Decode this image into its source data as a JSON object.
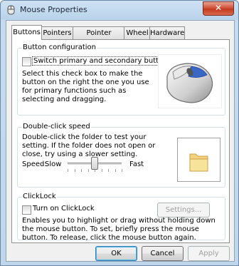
{
  "window": {
    "title": "Mouse Properties",
    "close_glyph": "✕"
  },
  "tabs": [
    {
      "label": "Buttons",
      "active": true
    },
    {
      "label": "Pointers",
      "active": false
    },
    {
      "label": "Pointer Options",
      "active": false
    },
    {
      "label": "Wheel",
      "active": false
    },
    {
      "label": "Hardware",
      "active": false
    }
  ],
  "button_config": {
    "legend": "Button configuration",
    "checkbox_label": "Switch primary and secondary buttons",
    "checked": false,
    "description": "Select this check box to make the button on the right the one you use for primary functions such as selecting and dragging."
  },
  "double_click": {
    "legend": "Double-click speed",
    "description": "Double-click the folder to test your setting. If the folder does not open or close, try using a slower setting.",
    "speed_label": "Speed:",
    "slow_label": "Slow",
    "fast_label": "Fast",
    "speed_value": 0.5
  },
  "clicklock": {
    "legend": "ClickLock",
    "checkbox_label": "Turn on ClickLock",
    "checked": false,
    "settings_label": "Settings...",
    "description": "Enables you to highlight or drag without holding down the mouse button. To set, briefly press the mouse button. To release, click the mouse button again."
  },
  "footer": {
    "ok_label": "OK",
    "cancel_label": "Cancel",
    "apply_label": "Apply"
  },
  "colors": {
    "accent": "#3c7fb1",
    "close": "#c23a1f"
  },
  "icons": {
    "title": "mouse-icon",
    "mouse_image": "mouse-illustration-icon",
    "folder": "folder-icon"
  }
}
